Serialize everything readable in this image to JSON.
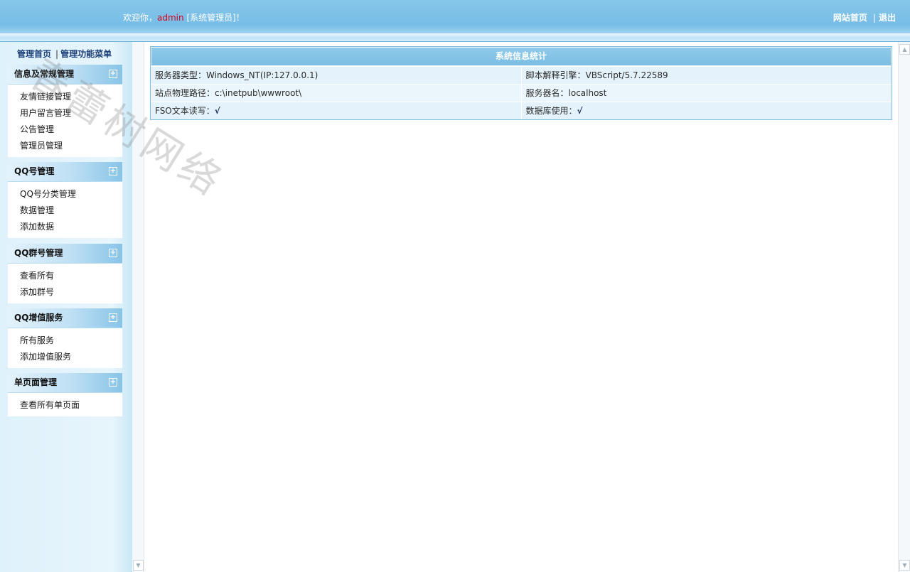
{
  "header": {
    "welcome_prefix": "欢迎你，",
    "username": "admin",
    "role": " [系统管理员]！",
    "links": [
      "网站首页",
      "退出"
    ]
  },
  "watermark": "春蕾树网络",
  "sidebar": {
    "top_links": [
      "管理首页",
      "管理功能菜单"
    ],
    "groups": [
      {
        "title": "信息及常规管理",
        "items": [
          "友情链接管理",
          "用户留言管理",
          "公告管理",
          "管理员管理"
        ]
      },
      {
        "title": "QQ号管理",
        "items": [
          "QQ号分类管理",
          "数据管理",
          "添加数据"
        ]
      },
      {
        "title": "QQ群号管理",
        "items": [
          "查看所有",
          "添加群号"
        ]
      },
      {
        "title": "QQ增值服务",
        "items": [
          "所有服务",
          "添加增值服务"
        ]
      },
      {
        "title": "单页面管理",
        "items": [
          "查看所有单页面"
        ]
      }
    ]
  },
  "info": {
    "title": "系统信息统计",
    "rows": [
      [
        {
          "label": "服务器类型：",
          "value": "Windows_NT(IP:127.0.0.1)"
        },
        {
          "label": "脚本解释引擎：",
          "value": "VBScript/5.7.22589"
        }
      ],
      [
        {
          "label": "站点物理路径：",
          "value": "c:\\inetpub\\wwwroot\\"
        },
        {
          "label": "服务器名：",
          "value": "localhost"
        }
      ],
      [
        {
          "label": "FSO文本读写：",
          "value": "√"
        },
        {
          "label": "数据库使用：",
          "value": "√"
        }
      ]
    ]
  },
  "icons": {
    "expand": "plus-icon",
    "scroll_up": "arrow-up-icon",
    "scroll_down": "arrow-down-icon"
  }
}
